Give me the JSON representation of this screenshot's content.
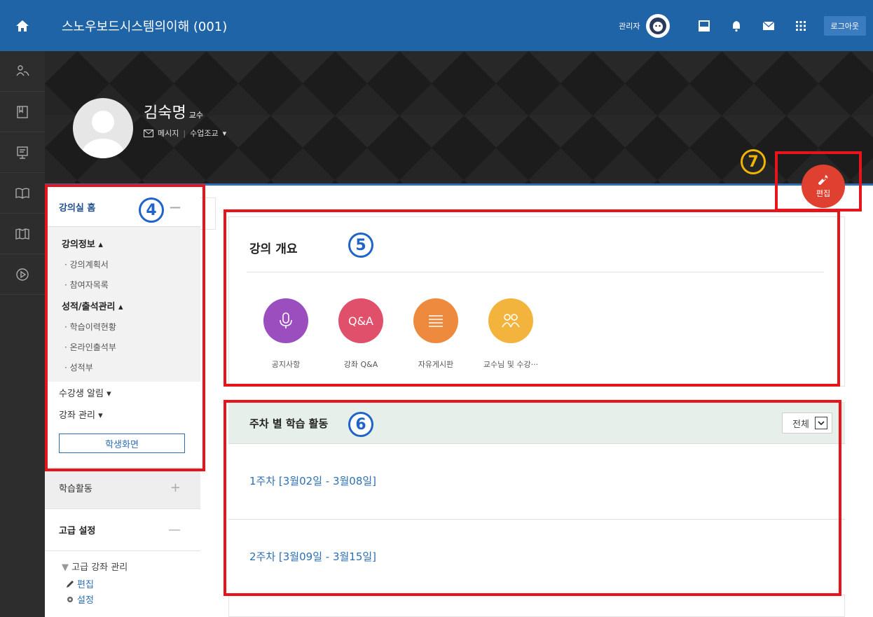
{
  "topbar": {
    "home_icon": "home-icon",
    "course_title": "스노우보드시스템의이해 (001)",
    "admin_label": "관리자",
    "icons": [
      "layout-icon",
      "bell-icon",
      "mail-icon",
      "apps-grid-icon"
    ],
    "logout_label": "로그아웃",
    "accent": "#1f64a6"
  },
  "rail": {
    "icons": [
      "people-icon",
      "notebook-icon",
      "presentation-icon",
      "book-icon",
      "map-book-icon",
      "play-circle-icon"
    ]
  },
  "profile": {
    "name": "김숙명",
    "role": "교수",
    "message_label": "메시지",
    "assistant_label": "수업조교"
  },
  "callouts": {
    "c4": "4",
    "c5": "5",
    "c6": "6",
    "c7": "7"
  },
  "edit_button": {
    "label": "편집",
    "color": "#e0402f"
  },
  "sidebar": {
    "home_label": "강의실 홈",
    "course_info": {
      "label": "강의정보",
      "items": [
        "강의계획서",
        "참여자목록"
      ]
    },
    "grades": {
      "label": "성적/출석관리",
      "items": [
        "학습이력현황",
        "온라인출석부",
        "성적부"
      ]
    },
    "notice_label": "수강생 알림",
    "manage_label": "강좌 관리",
    "student_view_label": "학생화면",
    "activities_label": "학습활동",
    "advanced_label": "고급 설정",
    "advanced_tree": {
      "root": "고급 강좌 관리",
      "edit": "편집",
      "settings": "설정"
    }
  },
  "overview": {
    "title": "강의 개요",
    "boards": [
      {
        "label": "공지사항",
        "icon": "microphone-icon",
        "color": "#9b4fbf",
        "glyph": ""
      },
      {
        "label": "강좌 Q&A",
        "icon": "qa-icon",
        "color": "#e0506a",
        "glyph": "Q&A"
      },
      {
        "label": "자유게시판",
        "icon": "list-icon",
        "color": "#ee8a3e",
        "glyph": ""
      },
      {
        "label": "교수님 및 수강···",
        "icon": "people-icon",
        "color": "#f2b43c",
        "glyph": ""
      }
    ]
  },
  "weekly": {
    "title": "주차 별 학습 활동",
    "filter_value": "전체",
    "weeks": [
      "1주차 [3월02일 - 3월08일]",
      "2주차 [3월09일 - 3월15일]"
    ]
  }
}
